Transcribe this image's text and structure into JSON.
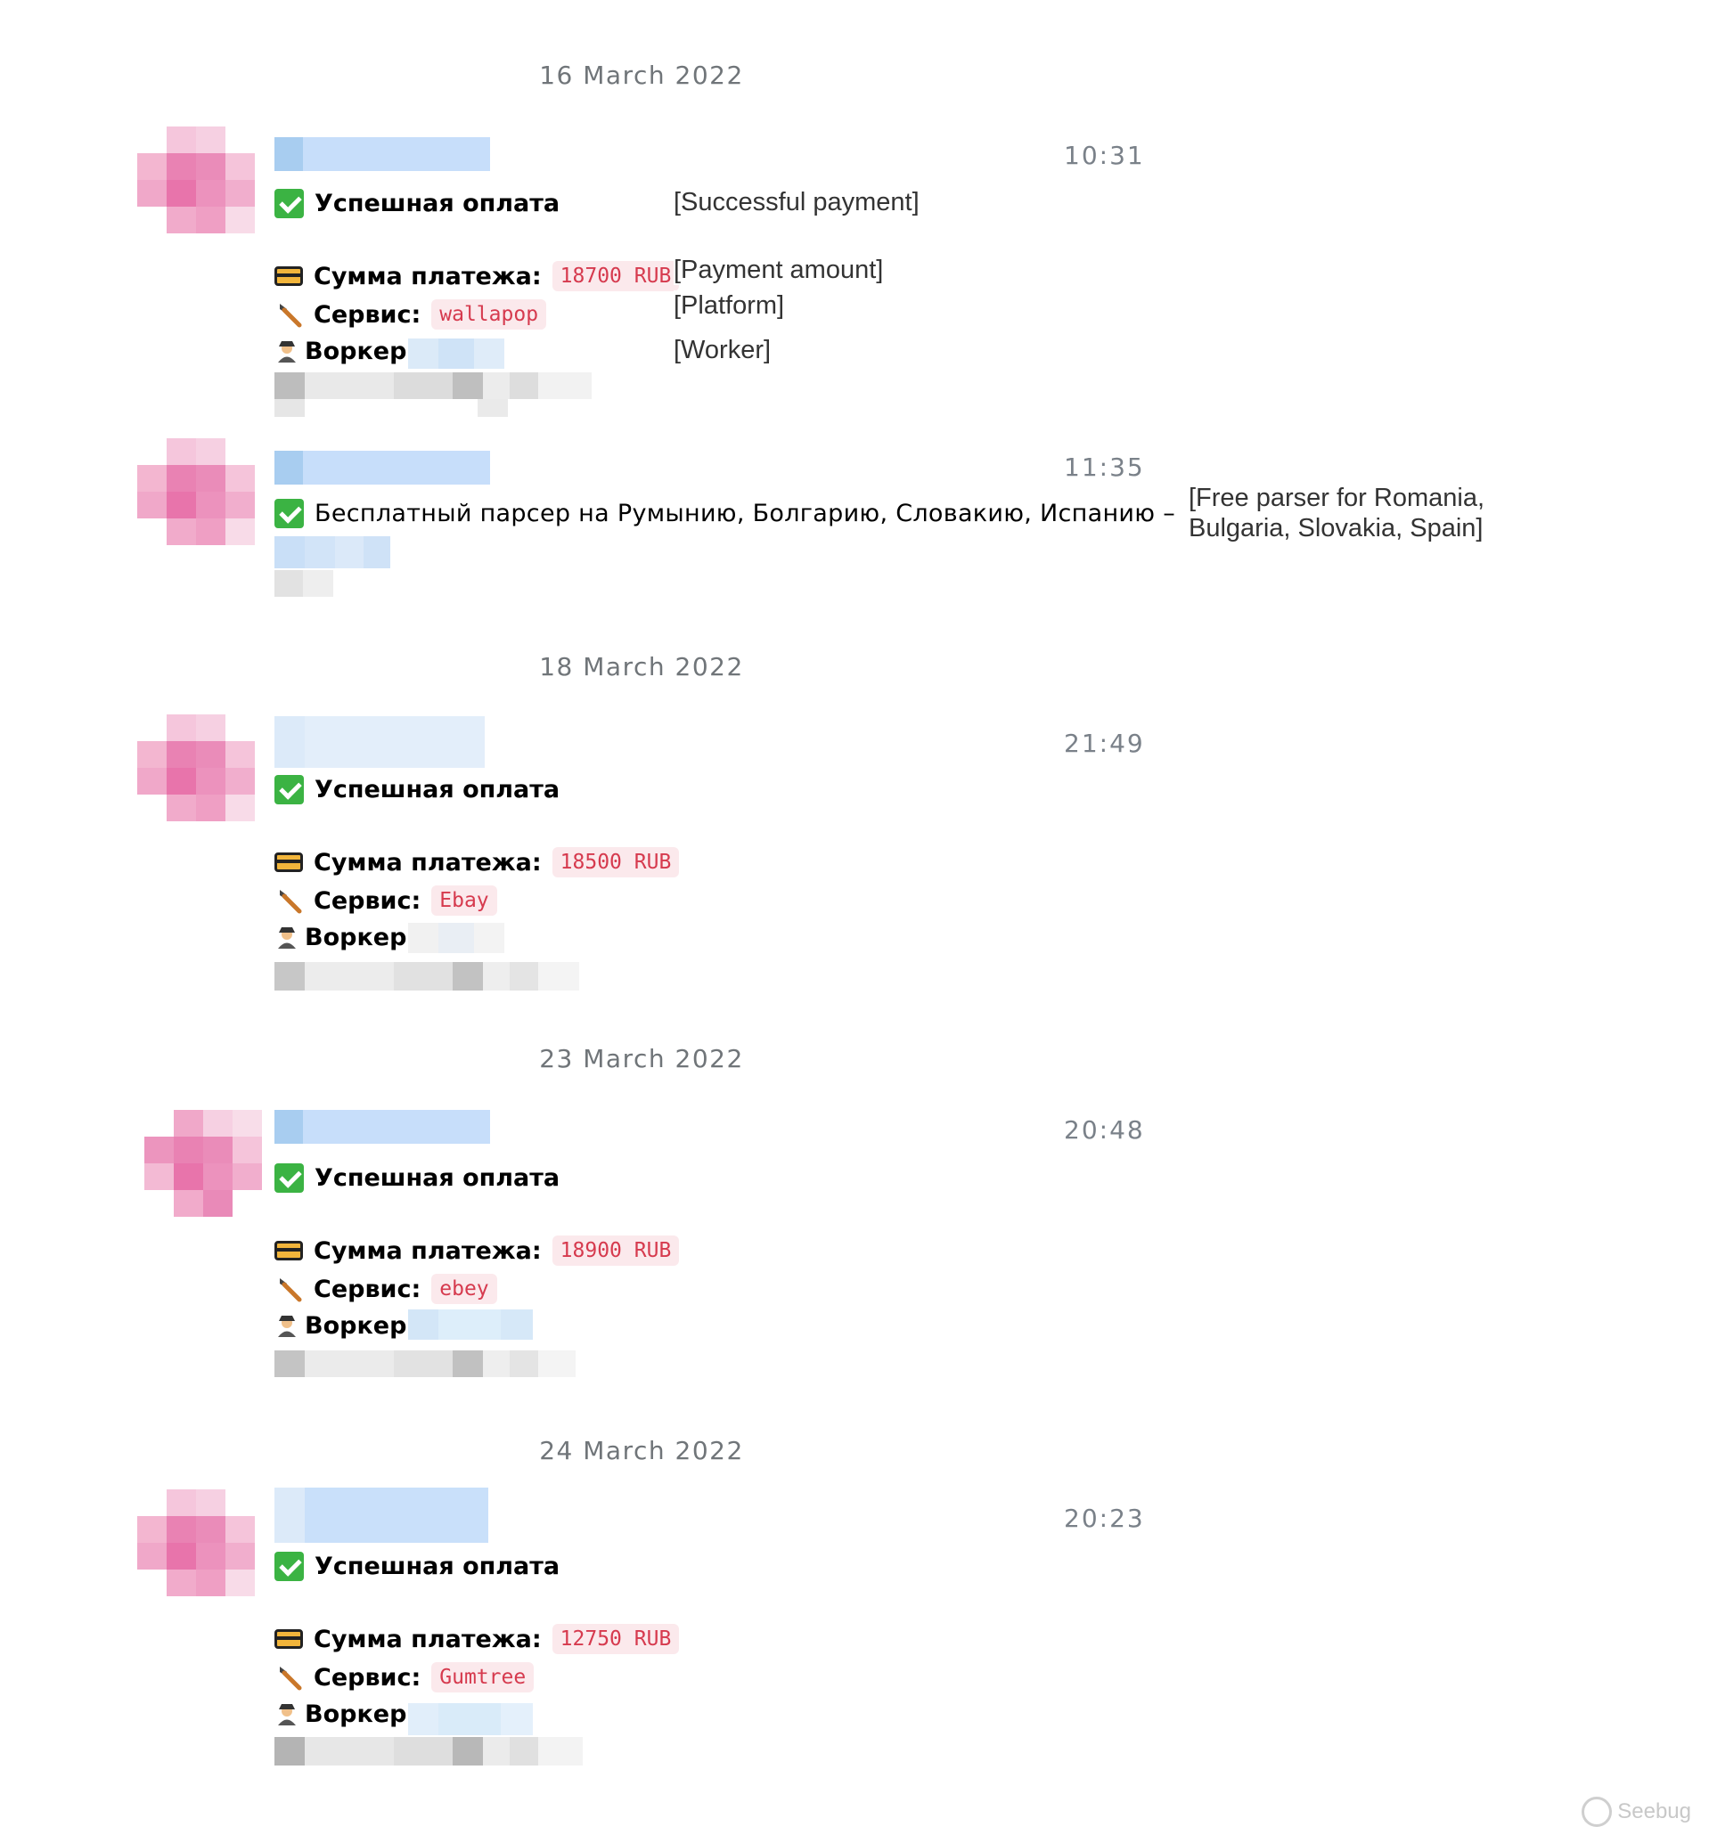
{
  "colors": {
    "success": "#3bb343",
    "code_text": "#d63a4e",
    "code_bg": "#fbe9ec",
    "date_text": "#707579",
    "time_text": "#7a8189"
  },
  "dates": [
    "16 March 2022",
    "18 March 2022",
    "23 March 2022",
    "24 March 2022"
  ],
  "messages": [
    {
      "time": "10:31",
      "status": "Успешная оплата",
      "amount_label": "Сумма платежа:",
      "amount": "18700 RUB",
      "service_label": "Сервис:",
      "service": "wallapop",
      "worker_label": "Воркер:"
    },
    {
      "time": "11:35",
      "text": "Бесплатный парсер на Румынию, Болгарию, Словакию, Испанию –"
    },
    {
      "time": "21:49",
      "status": "Успешная оплата",
      "amount_label": "Сумма платежа:",
      "amount": "18500 RUB",
      "service_label": "Сервис:",
      "service": "Ebay",
      "worker_label": "Воркер:"
    },
    {
      "time": "20:48",
      "status": "Успешная оплата",
      "amount_label": "Сумма платежа:",
      "amount": "18900 RUB",
      "service_label": "Сервис:",
      "service": "ebey",
      "worker_label": "Воркер:"
    },
    {
      "time": "20:23",
      "status": "Успешная оплата",
      "amount_label": "Сумма платежа:",
      "amount": "12750 RUB",
      "service_label": "Сервис:",
      "service": "Gumtree",
      "worker_label": "Воркер:"
    }
  ],
  "annotations": {
    "successful_payment": "[Successful payment]",
    "payment_amount": "[Payment amount]",
    "platform": "[Platform]",
    "worker": "[Worker]",
    "free_parser_line1": "[Free parser for Romania,",
    "free_parser_line2": "Bulgaria, Slovakia, Spain]"
  },
  "watermark": "Seebug"
}
